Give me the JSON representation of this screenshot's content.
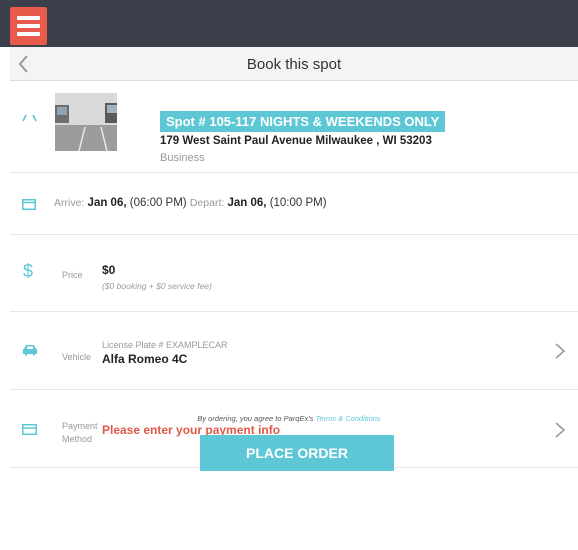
{
  "header": {
    "title": "Book this spot"
  },
  "spot": {
    "title": "Spot # 105-117 NIGHTS & WEEKENDS ONLY",
    "address": "179 West Saint Paul Avenue Milwaukee , WI 53203",
    "type": "Business"
  },
  "dates": {
    "arrive_label": "Arrive:",
    "arrive_value": "Jan 06,",
    "arrive_time": "(06:00 PM)",
    "depart_label": "Depart:",
    "depart_value": "Jan 06,",
    "depart_time": "(10:00 PM)"
  },
  "price": {
    "label": "Price",
    "value": "$0",
    "note": "($0 booking + $0 service fee)"
  },
  "vehicle": {
    "label": "Vehicle",
    "plate": "License Plate # EXAMPLECAR",
    "name": "Alfa Romeo 4C"
  },
  "payment": {
    "label_line1": "Payment",
    "label_line2": "Method",
    "warning": "Please enter your payment info"
  },
  "footer": {
    "terms_text": "By ordering, you agree to ParqEx's",
    "terms_link": "Terms & Conditions",
    "place_order": "PLACE ORDER"
  },
  "colors": {
    "accent": "#5dc7d6",
    "menu": "#e85a4a",
    "topbar": "#3a3f49",
    "warning": "#e0584a"
  }
}
